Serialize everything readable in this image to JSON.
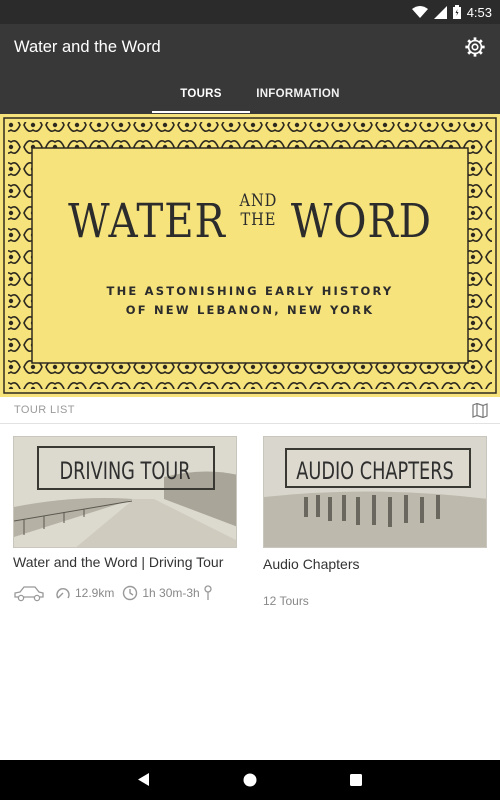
{
  "status": {
    "time": "4:53"
  },
  "app": {
    "title": "Water and the Word"
  },
  "tabs": [
    {
      "label": "TOURS",
      "active": true
    },
    {
      "label": "INFORMATION",
      "active": false
    }
  ],
  "hero": {
    "title_line": "WATER AND THE WORD",
    "title_word1": "WATER",
    "title_small1": "AND",
    "title_small2": "THE",
    "title_word2": "WORD",
    "subtitle1": "THE ASTONISHING EARLY HISTORY",
    "subtitle2": "OF NEW LEBANON, NEW YORK",
    "bg_color": "#f6e37c"
  },
  "tour_list": {
    "label": "TOUR LIST"
  },
  "cards": [
    {
      "thumb_label": "DRIVING TOUR",
      "title": "Water and the Word | Driving Tour",
      "distance": "12.9km",
      "duration": "1h 30m-3h",
      "icons": [
        "car-icon",
        "distance-icon",
        "clock-icon",
        "pin-icon"
      ]
    },
    {
      "thumb_label": "AUDIO CHAPTERS",
      "title": "Audio Chapters",
      "count": "12 Tours"
    }
  ]
}
